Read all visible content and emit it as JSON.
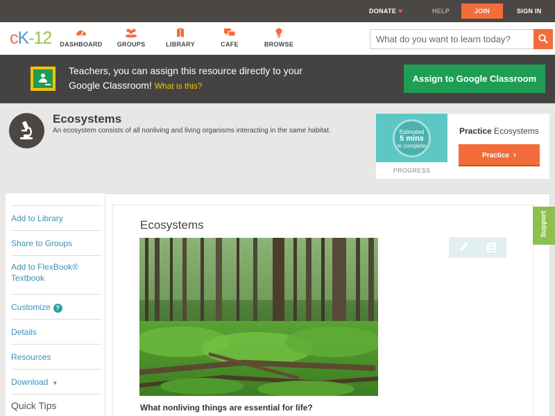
{
  "topbar": {
    "donate": "DONATE",
    "help": "HELP",
    "join": "JOIN",
    "signin": "SIGN IN"
  },
  "nav": {
    "logo": {
      "c": "c",
      "k": "K",
      "dash": "-",
      "num": "12"
    },
    "items": [
      {
        "label": "DASHBOARD",
        "icon": "dashboard-icon"
      },
      {
        "label": "GROUPS",
        "icon": "groups-icon"
      },
      {
        "label": "LIBRARY",
        "icon": "library-icon"
      },
      {
        "label": "CAFE",
        "icon": "cafe-icon"
      },
      {
        "label": "BROWSE",
        "icon": "browse-icon"
      }
    ],
    "search_placeholder": "What do you want to learn today?"
  },
  "banner": {
    "text": "Teachers, you can assign this resource directly to your Google Classroom!",
    "link": "What is this?",
    "button": "Assign to Google Classroom"
  },
  "concept": {
    "title": "Ecosystems",
    "description": "An ecosystem consists of all nonliving and living organisms interacting in the same habitat."
  },
  "progress": {
    "line1": "Estimated",
    "line2": "5 mins",
    "line3": "to complete",
    "label": "PROGRESS",
    "practice_bold": "Practice",
    "practice_rest": " Ecosystems",
    "practice_button": "Practice"
  },
  "sidebar": {
    "items": [
      {
        "label": "Add to Library"
      },
      {
        "label": "Share to Groups"
      },
      {
        "label": "Add to FlexBook®",
        "label2": "Textbook"
      },
      {
        "label": "Customize"
      },
      {
        "label": "Details"
      },
      {
        "label": "Resources"
      },
      {
        "label": "Download"
      }
    ],
    "quick_tips": "Quick Tips",
    "help_badge": "?"
  },
  "article": {
    "title": "Ecosystems",
    "question": "What nonliving things are essential for life?"
  },
  "support": "Support",
  "colors": {
    "accent": "#f36c3a",
    "banner": "#454341",
    "google_green": "#1f9d55",
    "link": "#3a8fbd",
    "support": "#8dc051"
  }
}
